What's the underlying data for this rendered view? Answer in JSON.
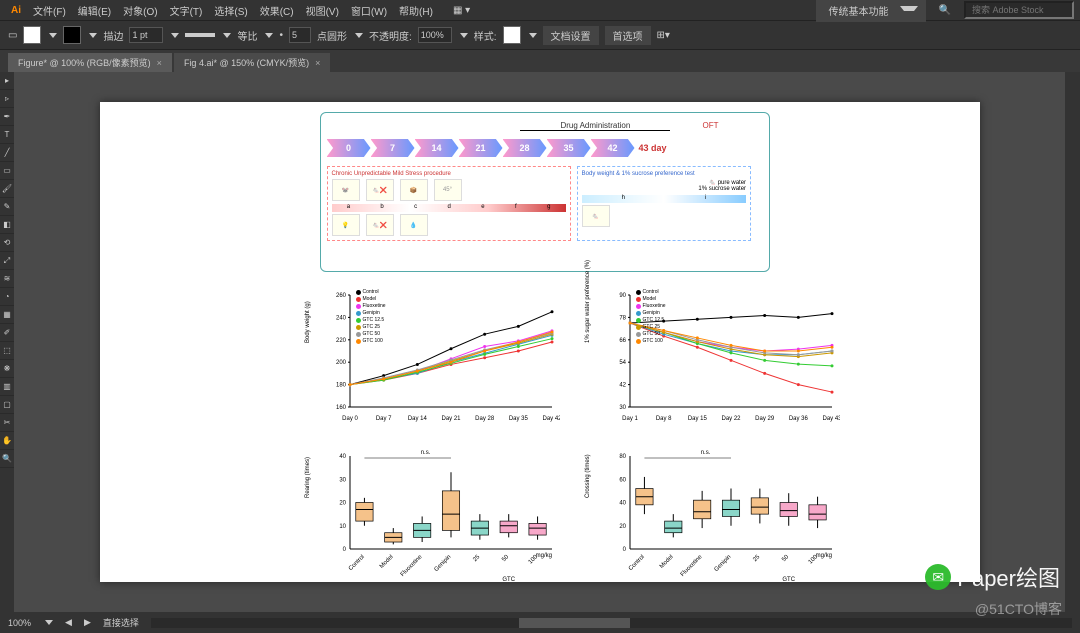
{
  "menu": {
    "file": "文件(F)",
    "edit": "编辑(E)",
    "object": "对象(O)",
    "type": "文字(T)",
    "select": "选择(S)",
    "effect": "效果(C)",
    "view": "视图(V)",
    "window": "窗口(W)",
    "help": "帮助(H)"
  },
  "menubar_right": {
    "workspace": "传统基本功能",
    "search_ph": "搜索 Adobe Stock"
  },
  "toolbar": {
    "stroke": "描边",
    "stroke_val": "1 pt",
    "ratio": "等比",
    "shape_count": "5",
    "shape_label": "点圆形",
    "opacity_label": "不透明度:",
    "opacity_val": "100%",
    "style": "样式:",
    "doc_setup": "文档设置",
    "prefs": "首选项"
  },
  "tabs": {
    "tab1": "Figure* @ 100% (RGB/像素预览)",
    "tab2": "Fig 4.ai* @ 150% (CMYK/预览)"
  },
  "status": {
    "zoom": "100%",
    "tool": "直接选择"
  },
  "diagram": {
    "drug_label": "Drug Administration",
    "oft": "OFT",
    "end_day": "43 day",
    "days": [
      "0",
      "7",
      "14",
      "21",
      "28",
      "35",
      "42"
    ],
    "stress_title": "Chronic Unpredictable Mild Stress procedure",
    "pref_title": "Body weight & 1% sucrose preference test",
    "pref_lines": [
      "pure water",
      "1% sucrose water"
    ],
    "stress_letters": [
      "a",
      "b",
      "c",
      "d",
      "e",
      "f",
      "g"
    ],
    "pref_letters": [
      "h",
      "i"
    ]
  },
  "legend_series": [
    {
      "name": "Control",
      "color": "#000"
    },
    {
      "name": "Model",
      "color": "#e33"
    },
    {
      "name": "Fluoxetine",
      "color": "#e3e"
    },
    {
      "name": "Genipin",
      "color": "#39c"
    },
    {
      "name": "GTC 12.5",
      "color": "#3c3"
    },
    {
      "name": "GTC 25",
      "color": "#c90"
    },
    {
      "name": "GTC 50",
      "color": "#999"
    },
    {
      "name": "GTC 100",
      "color": "#f80"
    }
  ],
  "chart_data": [
    {
      "id": "bodyweight",
      "type": "line",
      "title": "",
      "ylabel": "Body weight (g)",
      "xlabel": "",
      "ylim": [
        160,
        260
      ],
      "categories": [
        "Day 0",
        "Day 7",
        "Day 14",
        "Day 21",
        "Day 28",
        "Day 35",
        "Day 42"
      ],
      "series": [
        {
          "name": "Control",
          "values": [
            180,
            188,
            198,
            212,
            225,
            232,
            245
          ]
        },
        {
          "name": "Model",
          "values": [
            180,
            184,
            190,
            198,
            204,
            210,
            218
          ]
        },
        {
          "name": "Fluoxetine",
          "values": [
            180,
            185,
            192,
            203,
            214,
            219,
            228
          ]
        },
        {
          "name": "Genipin",
          "values": [
            180,
            185,
            190,
            200,
            208,
            216,
            224
          ]
        },
        {
          "name": "GTC 12.5",
          "values": [
            180,
            184,
            191,
            199,
            207,
            214,
            221
          ]
        },
        {
          "name": "GTC 25",
          "values": [
            180,
            185,
            192,
            201,
            210,
            217,
            225
          ]
        },
        {
          "name": "GTC 50",
          "values": [
            180,
            186,
            193,
            202,
            211,
            218,
            226
          ]
        },
        {
          "name": "GTC 100",
          "values": [
            180,
            185,
            192,
            200,
            210,
            218,
            227
          ]
        }
      ]
    },
    {
      "id": "sucrose",
      "type": "line",
      "title": "",
      "ylabel": "1% sugar water preference (%)",
      "xlabel": "",
      "ylim": [
        30,
        90
      ],
      "categories": [
        "Day 1",
        "Day 8",
        "Day 15",
        "Day 22",
        "Day 29",
        "Day 36",
        "Day 43"
      ],
      "series": [
        {
          "name": "Control",
          "values": [
            75,
            76,
            77,
            78,
            79,
            78,
            80
          ]
        },
        {
          "name": "Model",
          "values": [
            75,
            68,
            62,
            55,
            48,
            42,
            38
          ]
        },
        {
          "name": "Fluoxetine",
          "values": [
            75,
            70,
            65,
            62,
            60,
            61,
            63
          ]
        },
        {
          "name": "Genipin",
          "values": [
            75,
            69,
            64,
            60,
            58,
            58,
            60
          ]
        },
        {
          "name": "GTC 12.5",
          "values": [
            75,
            70,
            64,
            59,
            55,
            53,
            52
          ]
        },
        {
          "name": "GTC 25",
          "values": [
            75,
            70,
            65,
            61,
            58,
            57,
            59
          ]
        },
        {
          "name": "GTC 50",
          "values": [
            75,
            71,
            66,
            62,
            59,
            58,
            60
          ]
        },
        {
          "name": "GTC 100",
          "values": [
            75,
            71,
            67,
            63,
            60,
            60,
            62
          ]
        }
      ]
    },
    {
      "id": "rearing",
      "type": "box",
      "ylabel": "Rearing (times)",
      "ylim": [
        0,
        40
      ],
      "categories": [
        "Control",
        "Model",
        "Fluoxetine",
        "Genipin",
        "25",
        "50",
        "100"
      ],
      "xgroup": "GTC",
      "xunit": "mg/kg",
      "sig": "n.s.",
      "boxes": [
        {
          "min": 10,
          "q1": 12,
          "med": 17,
          "q3": 20,
          "max": 22,
          "color": "#f5c28a"
        },
        {
          "min": 2,
          "q1": 3,
          "med": 5,
          "q3": 7,
          "max": 9,
          "color": "#f5c28a"
        },
        {
          "min": 3,
          "q1": 5,
          "med": 8,
          "q3": 11,
          "max": 14,
          "color": "#8ad6c8"
        },
        {
          "min": 5,
          "q1": 8,
          "med": 15,
          "q3": 25,
          "max": 33,
          "color": "#f5c28a"
        },
        {
          "min": 4,
          "q1": 6,
          "med": 9,
          "q3": 12,
          "max": 15,
          "color": "#8ad6c8"
        },
        {
          "min": 5,
          "q1": 7,
          "med": 10,
          "q3": 12,
          "max": 15,
          "color": "#f7a8c9"
        },
        {
          "min": 4,
          "q1": 6,
          "med": 9,
          "q3": 11,
          "max": 14,
          "color": "#f7a8c9"
        }
      ]
    },
    {
      "id": "crossing",
      "type": "box",
      "ylabel": "Crossing (times)",
      "ylim": [
        0,
        80
      ],
      "categories": [
        "Control",
        "Model",
        "Fluoxetine",
        "Genipin",
        "25",
        "50",
        "100"
      ],
      "xgroup": "GTC",
      "xunit": "mg/kg",
      "sig": "n.s.",
      "boxes": [
        {
          "min": 30,
          "q1": 38,
          "med": 45,
          "q3": 52,
          "max": 62,
          "color": "#f5c28a"
        },
        {
          "min": 10,
          "q1": 14,
          "med": 18,
          "q3": 24,
          "max": 30,
          "color": "#8ad6c8"
        },
        {
          "min": 18,
          "q1": 26,
          "med": 32,
          "q3": 42,
          "max": 50,
          "color": "#f5c28a"
        },
        {
          "min": 20,
          "q1": 28,
          "med": 34,
          "q3": 42,
          "max": 52,
          "color": "#8ad6c8"
        },
        {
          "min": 22,
          "q1": 30,
          "med": 36,
          "q3": 44,
          "max": 52,
          "color": "#f5c28a"
        },
        {
          "min": 20,
          "q1": 28,
          "med": 33,
          "q3": 40,
          "max": 48,
          "color": "#f7a8c9"
        },
        {
          "min": 18,
          "q1": 25,
          "med": 30,
          "q3": 38,
          "max": 45,
          "color": "#f7a8c9"
        }
      ]
    }
  ],
  "watermarks": {
    "wm1": "Paper绘图",
    "wm2": "@51CTO博客"
  }
}
